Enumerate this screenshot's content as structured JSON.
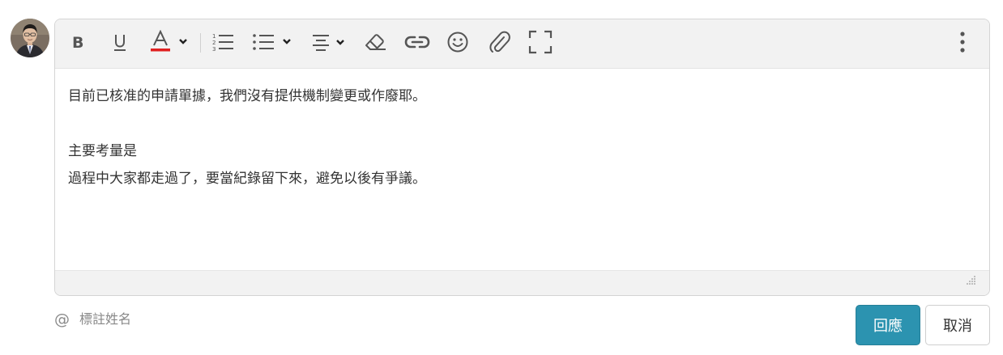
{
  "user": {
    "avatar_icon": "user-avatar-photo"
  },
  "toolbar": {
    "buttons": [
      {
        "name": "bold",
        "icon": "bold-icon"
      },
      {
        "name": "underline",
        "icon": "underline-icon"
      },
      {
        "name": "font-color",
        "icon": "font-color-icon",
        "color": "#e02020"
      },
      {
        "name": "ordered-list",
        "icon": "ordered-list-icon"
      },
      {
        "name": "unordered-list",
        "icon": "unordered-list-icon"
      },
      {
        "name": "align",
        "icon": "align-icon"
      },
      {
        "name": "clear-format",
        "icon": "eraser-icon"
      },
      {
        "name": "link",
        "icon": "link-icon"
      },
      {
        "name": "emoji",
        "icon": "smiley-icon"
      },
      {
        "name": "attachment",
        "icon": "paperclip-icon"
      },
      {
        "name": "fullscreen",
        "icon": "fullscreen-icon"
      },
      {
        "name": "more",
        "icon": "more-vertical-icon"
      }
    ]
  },
  "editor": {
    "lines": [
      "目前已核准的申請單據，我們沒有提供機制變更或作廢耶。",
      "",
      "主要考量是",
      "過程中大家都走過了，要當紀錄留下來，避免以後有爭議。"
    ]
  },
  "mention": {
    "symbol": "@",
    "placeholder": "標註姓名"
  },
  "actions": {
    "reply_label": "回應",
    "cancel_label": "取消"
  },
  "colors": {
    "primary": "#2c93b0",
    "toolbar_bg": "#f2f2f2",
    "icon": "#555555",
    "font_color_bar": "#e02020"
  }
}
